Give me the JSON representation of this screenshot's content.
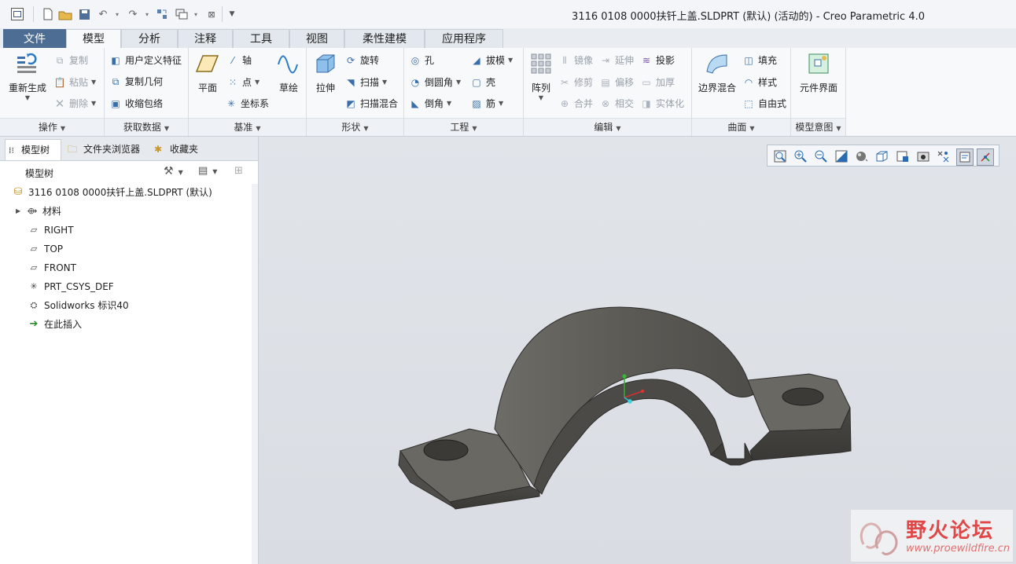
{
  "window": {
    "title": "3116 0108 0000扶钎上盖.SLDPRT (默认) (活动的) - Creo Parametric 4.0"
  },
  "tabs": [
    {
      "label": "文件"
    },
    {
      "label": "模型"
    },
    {
      "label": "分析"
    },
    {
      "label": "注释"
    },
    {
      "label": "工具"
    },
    {
      "label": "视图"
    },
    {
      "label": "柔性建模"
    },
    {
      "label": "应用程序"
    }
  ],
  "ribbon": {
    "operations": {
      "label": "操作",
      "regenerate": "重新生成",
      "copy": "复制",
      "paste": "粘贴",
      "delete": "删除"
    },
    "get_data": {
      "label": "获取数据",
      "udf": "用户定义特征",
      "copy_geom": "复制几何",
      "shrinkwrap": "收缩包络"
    },
    "datum": {
      "label": "基准",
      "plane": "平面",
      "axis": "轴",
      "point": "点",
      "csys": "坐标系",
      "sketch": "草绘"
    },
    "shapes": {
      "label": "形状",
      "extrude": "拉伸",
      "revolve": "旋转",
      "sweep": "扫描",
      "swept_blend": "扫描混合"
    },
    "engineering": {
      "label": "工程",
      "hole": "孔",
      "draft": "拔模",
      "round": "倒圆角",
      "shell": "壳",
      "chamfer": "倒角",
      "rib": "筋"
    },
    "editing": {
      "label": "编辑",
      "pattern": "阵列",
      "mirror": "镜像",
      "extend": "延伸",
      "project": "投影",
      "trim": "修剪",
      "offset": "偏移",
      "thicken": "加厚",
      "merge": "合并",
      "intersect": "相交",
      "solidify": "实体化"
    },
    "surfaces": {
      "label": "曲面",
      "boundary_blend": "边界混合",
      "fill": "填充",
      "style": "样式",
      "freestyle": "自由式"
    },
    "model_intent": {
      "label": "模型意图",
      "component_interface": "元件界面"
    }
  },
  "left_panel": {
    "tabs": [
      {
        "label": "模型树"
      },
      {
        "label": "文件夹浏览器"
      },
      {
        "label": "收藏夹"
      }
    ],
    "tree_header": "模型树",
    "tree": [
      {
        "label": "3116 0108 0000扶钎上盖.SLDPRT (默认)",
        "icon": "part-icon"
      },
      {
        "label": "材料",
        "icon": "material-icon"
      },
      {
        "label": "RIGHT",
        "icon": "datum-plane-icon"
      },
      {
        "label": "TOP",
        "icon": "datum-plane-icon"
      },
      {
        "label": "FRONT",
        "icon": "datum-plane-icon"
      },
      {
        "label": "PRT_CSYS_DEF",
        "icon": "csys-icon"
      },
      {
        "label": "Solidworks 标识40",
        "icon": "import-feature-icon"
      },
      {
        "label": "在此插入",
        "icon": "insert-here-arrow-icon"
      }
    ]
  },
  "watermark": {
    "title": "野火论坛",
    "url": "www.proewildfire.cn"
  },
  "colors": {
    "file_tab": "#4d6d95",
    "ribbon_bg": "#f7f9fb",
    "viewport_bg": "#dfe3e8",
    "model": "#5b5a56",
    "watermark": "#e04040"
  }
}
